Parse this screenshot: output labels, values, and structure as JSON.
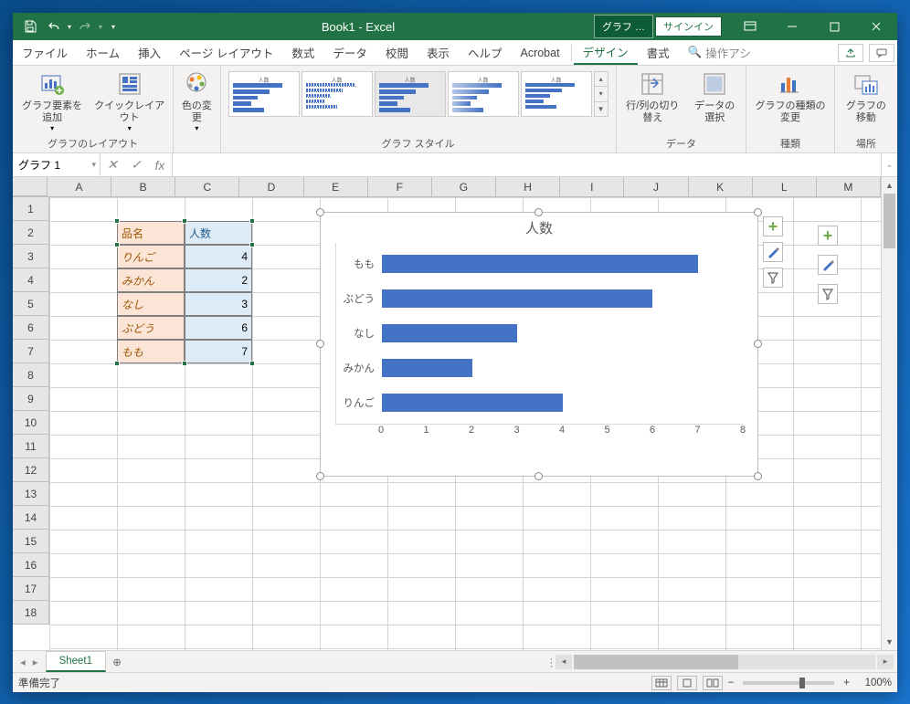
{
  "titlebar": {
    "title": "Book1 - Excel",
    "context_tab": "グラフ …",
    "signin": "サインイン"
  },
  "tabs": {
    "file": "ファイル",
    "home": "ホーム",
    "insert": "挿入",
    "pagelayout": "ページ レイアウト",
    "formulas": "数式",
    "data": "データ",
    "review": "校閲",
    "view": "表示",
    "help": "ヘルプ",
    "acrobat": "Acrobat",
    "design": "デザイン",
    "format": "書式",
    "tellme": "操作アシ"
  },
  "ribbon": {
    "layout_group": "グラフのレイアウト",
    "add_element": "グラフ要素を追加",
    "quick_layout": "クイックレイアウト",
    "change_colors": "色の変更",
    "styles_group": "グラフ スタイル",
    "data_group": "データ",
    "switch_rowcol": "行/列の切り替え",
    "select_data": "データの選択",
    "type_group": "種類",
    "change_type": "グラフの種類の変更",
    "location_group": "場所",
    "move_chart": "グラフの移動"
  },
  "namebox": "グラフ 1",
  "columns": [
    "A",
    "B",
    "C",
    "D",
    "E",
    "F",
    "G",
    "H",
    "I",
    "J",
    "K",
    "L",
    "M"
  ],
  "rows": [
    "1",
    "2",
    "3",
    "4",
    "5",
    "6",
    "7",
    "8",
    "9",
    "10",
    "11",
    "12",
    "13",
    "14",
    "15",
    "16",
    "17",
    "18"
  ],
  "table": {
    "header_item": "品名",
    "header_count": "人数",
    "rows": [
      {
        "item": "りんご",
        "count": "4"
      },
      {
        "item": "みかん",
        "count": "2"
      },
      {
        "item": "なし",
        "count": "3"
      },
      {
        "item": "ぶどう",
        "count": "6"
      },
      {
        "item": "もも",
        "count": "7"
      }
    ]
  },
  "chart_data": {
    "type": "bar",
    "title": "人数",
    "xlabel": "",
    "ylabel": "",
    "categories": [
      "もも",
      "ぶどう",
      "なし",
      "みかん",
      "りんご"
    ],
    "values": [
      7,
      6,
      3,
      2,
      4
    ],
    "xlim": [
      0,
      8
    ],
    "ticks": [
      0,
      1,
      2,
      3,
      4,
      5,
      6,
      7,
      8
    ]
  },
  "sheet": {
    "name": "Sheet1"
  },
  "status": {
    "ready": "準備完了",
    "zoom": "100%"
  }
}
